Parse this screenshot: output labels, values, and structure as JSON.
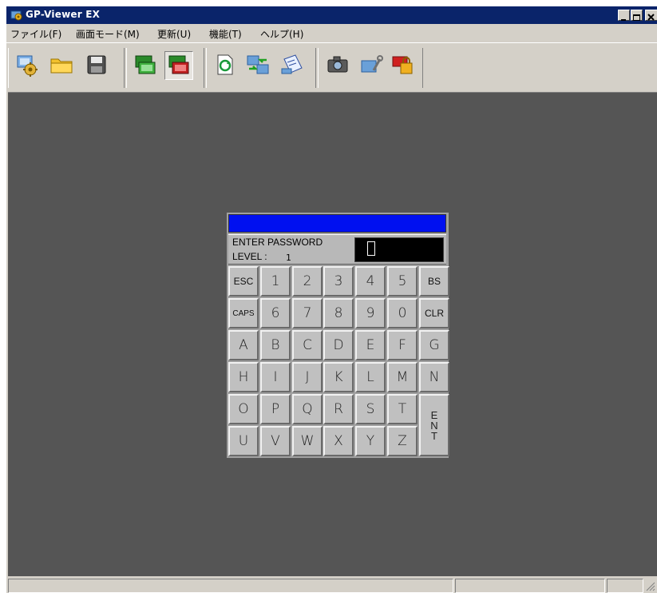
{
  "window": {
    "title": "GP-Viewer EX"
  },
  "menu": {
    "items": [
      {
        "label": "ファイル(F)"
      },
      {
        "label": "画面モード(M)"
      },
      {
        "label": "更新(U)"
      },
      {
        "label": "機能(T)"
      },
      {
        "label": "ヘルプ(H)"
      }
    ]
  },
  "toolbar": {
    "buttons": [
      {
        "icon": "connect-icon"
      },
      {
        "icon": "open-folder-icon"
      },
      {
        "icon": "save-disk-icon"
      },
      {
        "icon": "monitor-display-icon"
      },
      {
        "icon": "monitor-alarm-icon",
        "pressed": true
      },
      {
        "icon": "refresh-document-icon"
      },
      {
        "icon": "transfer-icon"
      },
      {
        "icon": "print-document-icon"
      },
      {
        "icon": "camera-icon"
      },
      {
        "icon": "settings-tool-icon"
      },
      {
        "icon": "id-lock-icon"
      }
    ]
  },
  "keypad": {
    "prompt": "ENTER PASSWORD",
    "level_label": "LEVEL :",
    "level_value": "1",
    "title_bar_color": "#0010f0",
    "rows": [
      [
        "ESC",
        "1",
        "2",
        "3",
        "4",
        "5",
        "BS"
      ],
      [
        "CAPS",
        "6",
        "7",
        "8",
        "9",
        "0",
        "CLR"
      ],
      [
        "A",
        "B",
        "C",
        "D",
        "E",
        "F",
        "G"
      ],
      [
        "H",
        "I",
        "J",
        "K",
        "L",
        "M",
        "N"
      ],
      [
        "O",
        "P",
        "Q",
        "R",
        "S",
        "T"
      ],
      [
        "U",
        "V",
        "W",
        "X",
        "Y",
        "Z"
      ]
    ],
    "enter_key": [
      "E",
      "N",
      "T"
    ]
  },
  "colors": {
    "title_bar": "#0a246a",
    "workspace": "#555555",
    "window_chrome": "#d4d0c8"
  }
}
